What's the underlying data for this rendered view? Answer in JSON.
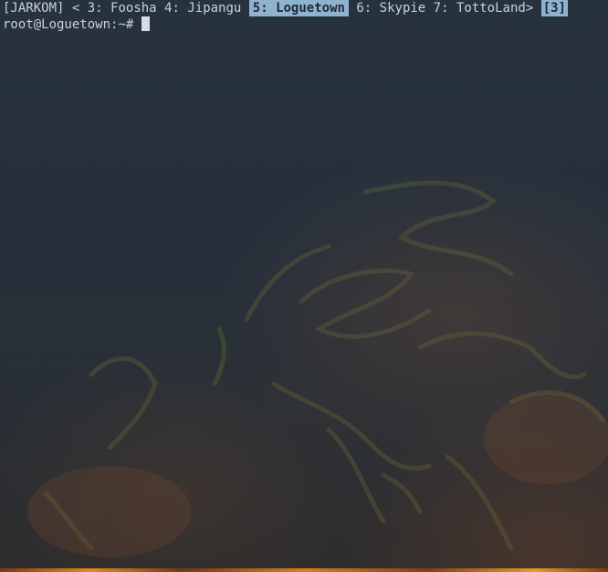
{
  "tmux": {
    "session_label": "[JARKOM]",
    "scroll_left_marker": "<",
    "windows": [
      {
        "label": "3: Foosha",
        "active": false
      },
      {
        "label": "4: Jipangu",
        "active": false
      },
      {
        "label": "5: Loguetown",
        "active": true
      },
      {
        "label": "6: Skypie",
        "active": false
      },
      {
        "label": "7: TottoLand",
        "active": false
      }
    ],
    "scroll_right_marker": ">",
    "overflow_label": "[3]"
  },
  "terminal": {
    "prompt": "root@Loguetown:~#"
  },
  "colors": {
    "background": "#232c37",
    "text": "#c9d1d9",
    "active_window_bg": "#8fb3cf",
    "active_window_fg": "#1f2935"
  }
}
